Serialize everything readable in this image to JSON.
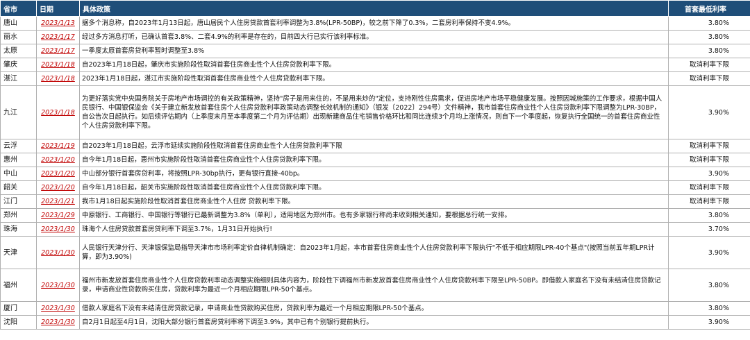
{
  "headers": {
    "city": "省市",
    "date": "日期",
    "policy": "具体政策",
    "rate": "首套最低利率"
  },
  "rows": [
    {
      "city": "唐山",
      "date": "2023/1/13",
      "policy": "据多个消息称，自2023年1月13日起，唐山居民个人住房贷款首套利率调整为3.8%(LPR-50BP)，较之前下降了0.3%，二套房利率保持不变4.9%。",
      "rate": "3.80%",
      "h": 1
    },
    {
      "city": "丽水",
      "date": "2023/1/17",
      "policy": "经过多方消息打听，已确认首套3.8%、二套4.9%的利率是存在的，目前四大行已实行该利率标准。",
      "rate": "3.80%",
      "h": 1
    },
    {
      "city": "太原",
      "date": "2023/1/17",
      "policy": "一季度太原首套房贷利率暂时调整至3.8%",
      "rate": "3.80%",
      "h": 1
    },
    {
      "city": "肇庆",
      "date": "2023/1/18",
      "policy": "自2023年1月18日起，肇庆市实施阶段性取消首套住房商业性个人住房贷款利率下限。",
      "rate": "取消利率下限",
      "h": 1
    },
    {
      "city": "湛江",
      "date": "2023/1/18",
      "policy": "2023年1月18日起，湛江市实施阶段性取消首套住房商业性个人住房贷款利率下限。",
      "rate": "取消利率下限",
      "h": 1
    },
    {
      "city": "九江",
      "date": "2023/1/18",
      "policy": "为更好落实党中央国务院关于房地产市场调控的有关政策精神，坚持\"房子是用来住的，不是用来炒的\"定位，支持刚性住房需求，促进房地产市场平稳健康发展。按照因城施策的工作要求，根据中国人民银行、中国银保监会《关于建立新发放首套住房个人住房贷款利率政策动态调整长效机制的通知》（银发〔2022〕294号）文件精神，我市首套住房商业性个人住房贷款利率下限调整为LPR-30BP，自公告次日起执行。如后续评估期内（上季度末月至本季度第二个月为评估期）出现新建商品住宅销售价格环比和同比连续3个月均上涨情况，则自下一个季度起，恢复执行全国统一的首套住房商业性个人住房贷款利率下限。",
      "rate": "3.90%",
      "h": 3
    },
    {
      "city": "云浮",
      "date": "2023/1/19",
      "policy": "自2023年1月18日起，云浮市延续实施阶段性取消首套住房商业性个人住房贷款利率下限",
      "rate": "取消利率下限",
      "h": 1
    },
    {
      "city": "惠州",
      "date": "2023/1/20",
      "policy": "自今年1月18日起，惠州市实施阶段性取消首套住房商业性个人住房贷款利率下限。",
      "rate": "取消利率下限",
      "h": 1
    },
    {
      "city": "中山",
      "date": "2023/1/20",
      "policy": "中山部分银行首套房贷利率，将按照LPR-30bp执行，更有银行直接-40bp。",
      "rate": "3.90%",
      "h": 1
    },
    {
      "city": "韶关",
      "date": "2023/1/20",
      "policy": "自今年1月18日起，韶关市实施阶段性取消首套住房商业性个人住房贷款利率下限。",
      "rate": "取消利率下限",
      "h": 1
    },
    {
      "city": "江门",
      "date": "2023/1/21",
      "policy": "我市1月18日起实施阶段性取消首套住房商业性个人住房 贷款利率下限。",
      "rate": "取消利率下限",
      "h": 1
    },
    {
      "city": "郑州",
      "date": "2023/1/29",
      "policy": "中原银行、工商银行、中国银行等银行已最新调整为3.8%（单利），适用地区为郑州市。也有多家银行称尚未收到相关通知，要根据总行统一安排。",
      "rate": "3.80%",
      "h": 1
    },
    {
      "city": "珠海",
      "date": "2023/1/30",
      "policy": "珠海个人住房贷款首套房贷利率下调至3.7%，1月31日开始执行!",
      "rate": "3.70%",
      "h": 1
    },
    {
      "city": "天津",
      "date": "2023/1/30",
      "policy": "人民银行天津分行、天津银保监局指导天津市市场利率定价自律机制确定：自2023年1月起，本市首套住房商业性个人住房贷款利率下限执行\"不低于相应期限LPR-40个基点\"(按照当前五年期LPR计算，即为3.90%)",
      "rate": "3.90%",
      "h": 2
    },
    {
      "city": "福州",
      "date": "2023/1/30",
      "policy": "福州市新发放首套住房商业性个人住房贷款利率动态调整实施细则具体内容为，阶段性下调福州市新发放首套住房商业性个人住房贷款利率下限至LPR-50BP。即借款人家庭名下没有未结清住房贷款记录，申请商业性贷款购买住房，贷款利率为最近一个月相应期限LPR-50个基点。",
      "rate": "3.80%",
      "h": 2
    },
    {
      "city": "厦门",
      "date": "2023/1/30",
      "policy": "借款人家庭名下没有未结清住房贷款记录，申请商业性贷款购买住房，贷款利率为最近一个月相应期限LPR-50个基点。",
      "rate": "3.80%",
      "h": 1
    },
    {
      "city": "沈阳",
      "date": "2023/1/30",
      "policy": "自2月1日起至4月1日，沈阳大部分银行首套房贷利率将下调至3.9%，其中已有个别银行提前执行。",
      "rate": "3.90%",
      "h": 1
    }
  ]
}
